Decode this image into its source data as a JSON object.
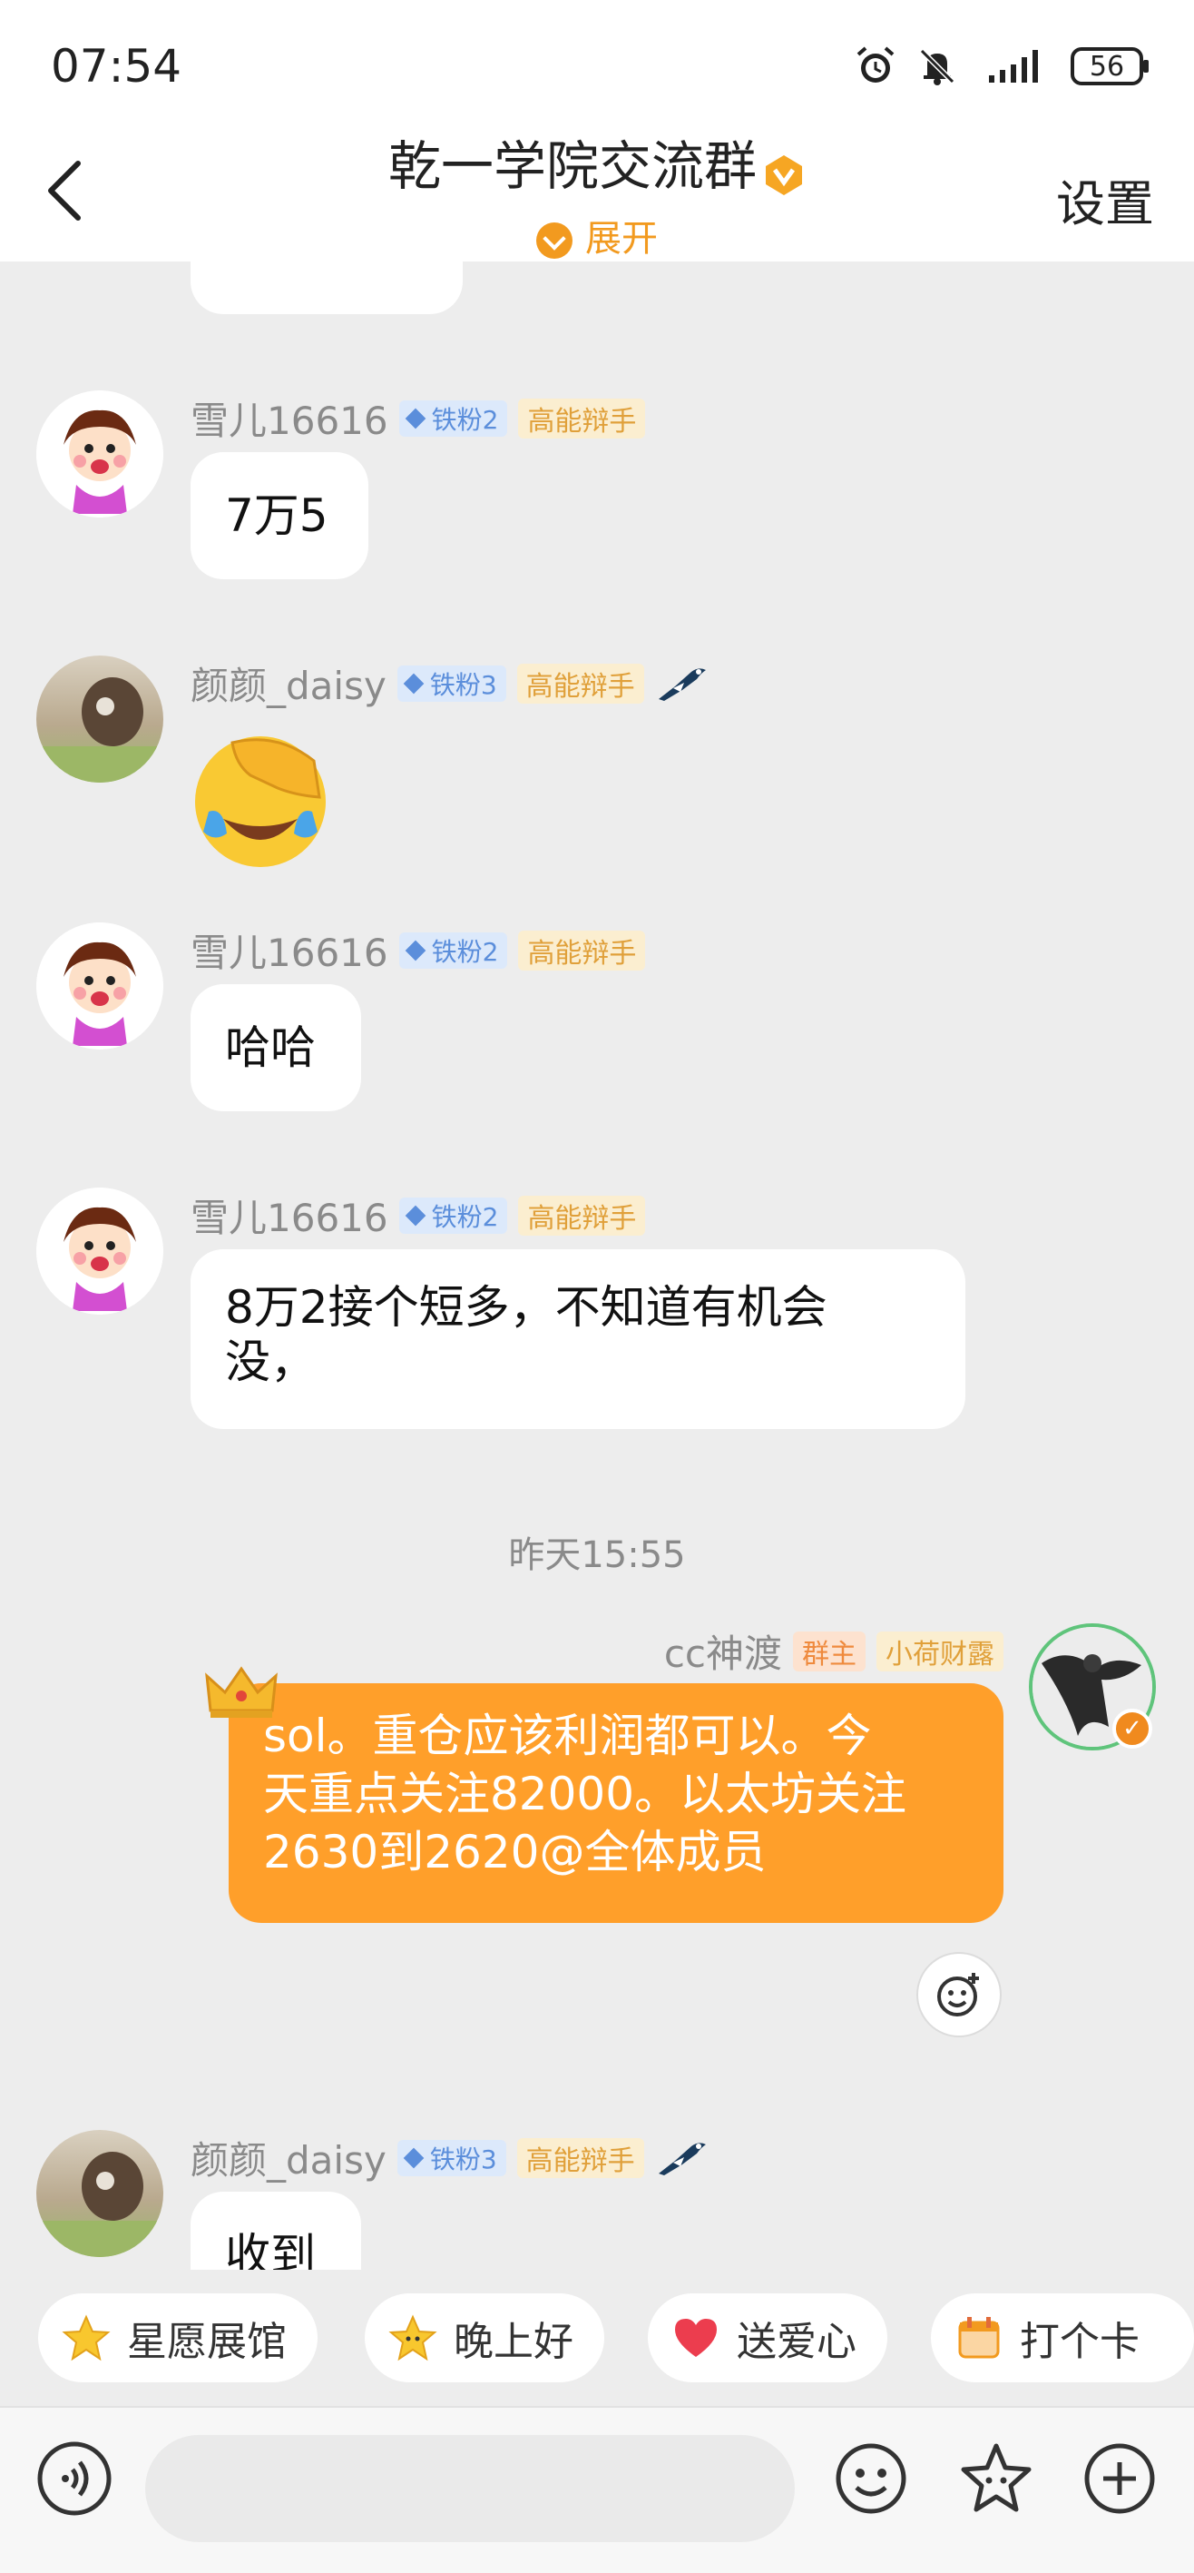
{
  "status_bar": {
    "time": "07:54",
    "battery": "56"
  },
  "header": {
    "title": "乾一学院交流群",
    "expand_label": "展开",
    "settings_label": "设置"
  },
  "messages": [
    {
      "name": "雪儿16616",
      "fan_badge": "铁粉2",
      "title_badge": "高能辩手",
      "text": "7万5"
    },
    {
      "name": "颜颜_daisy",
      "fan_badge": "铁粉3",
      "title_badge": "高能辩手",
      "sticker": "facepalm-laughing-emoji"
    },
    {
      "name": "雪儿16616",
      "fan_badge": "铁粉2",
      "title_badge": "高能辩手",
      "text": "哈哈"
    },
    {
      "name": "雪儿16616",
      "fan_badge": "铁粉2",
      "title_badge": "高能辩手",
      "text_line1": "8万2接个短多，不知道有机会",
      "text_line2": "没，"
    },
    {
      "name": "cc神渡",
      "role_badge": "群主",
      "title_badge": "小荷财露",
      "text_line1": "sol。重仓应该利润都可以。今",
      "text_line2": "天重点关注82000。以太坊关注",
      "text_line3": "2630到2620@全体成员"
    },
    {
      "name": "颜颜_daisy",
      "fan_badge": "铁粉3",
      "title_badge": "高能辩手",
      "text": "收到"
    }
  ],
  "time_separator": "昨天15:55",
  "quick_replies": [
    {
      "label": "星愿展馆",
      "icon": "star-icon"
    },
    {
      "label": "晚上好",
      "icon": "star-face-icon"
    },
    {
      "label": "送爱心",
      "icon": "heart-icon"
    },
    {
      "label": "打个卡",
      "icon": "calendar-icon"
    }
  ],
  "colors": {
    "accent": "#ff9f2a",
    "expand": "#f29a1f",
    "fan_badge": "#5b8edb",
    "high_badge": "#e0a03a"
  }
}
